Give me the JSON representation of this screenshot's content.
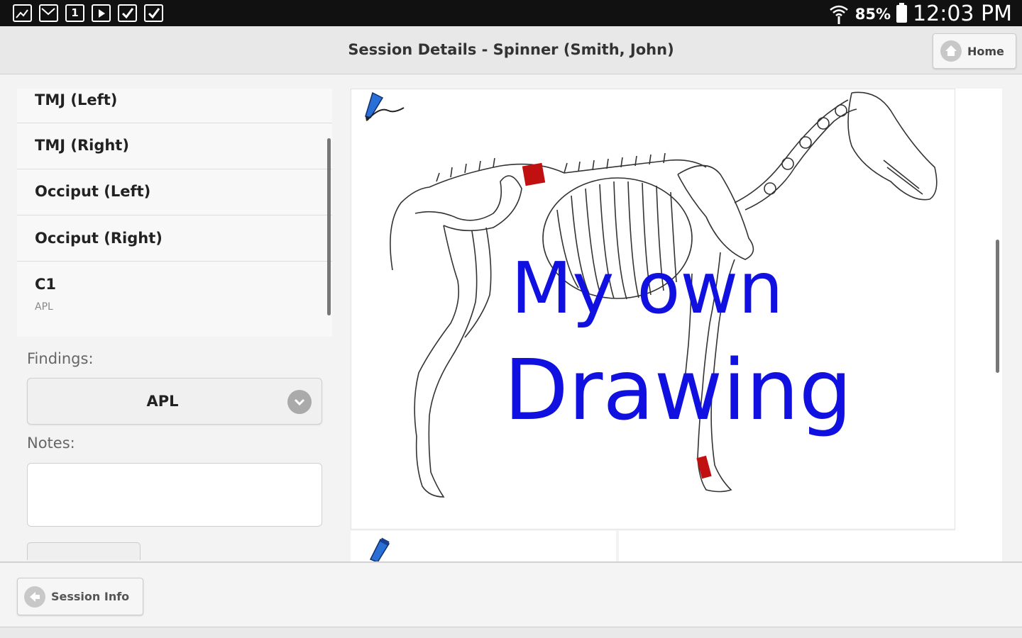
{
  "status_bar": {
    "notification_icons": [
      "gallery-icon",
      "gmail-icon",
      "calendar-icon",
      "play-store-icon",
      "check-bag-icon",
      "check-bag-icon"
    ],
    "calendar_day": "1",
    "battery": "85%",
    "time": "12:03 PM"
  },
  "header": {
    "title": "Session Details - Spinner (Smith, John)",
    "home_label": "Home"
  },
  "list": {
    "items": [
      {
        "label": "TMJ (Left)",
        "sub": ""
      },
      {
        "label": "TMJ (Right)",
        "sub": ""
      },
      {
        "label": "Occiput (Left)",
        "sub": ""
      },
      {
        "label": "Occiput (Right)",
        "sub": ""
      },
      {
        "label": "C1",
        "sub": "APL"
      }
    ]
  },
  "form": {
    "findings_label": "Findings:",
    "findings_value": "APL",
    "notes_label": "Notes:",
    "notes_value": ""
  },
  "drawing": {
    "handwriting_line1": "My own",
    "handwriting_line2": "Drawing",
    "ink_color": "#1010e0",
    "marker_color": "#c01010"
  },
  "footer": {
    "session_info_label": "Session Info"
  }
}
